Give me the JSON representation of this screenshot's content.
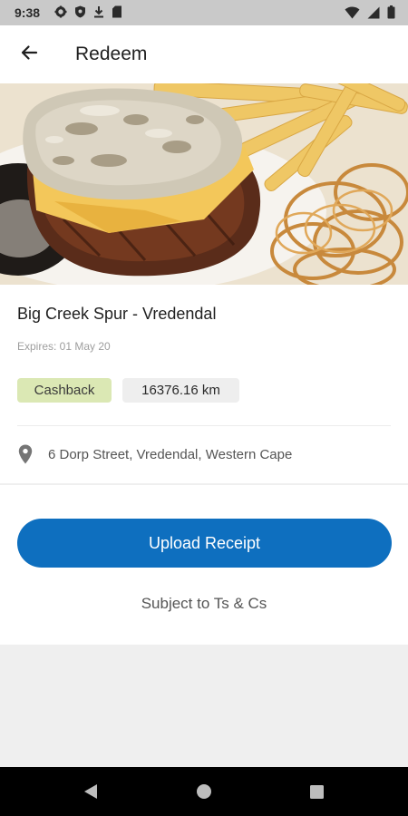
{
  "status_bar": {
    "time": "9:38",
    "left_icons": [
      "gear-icon",
      "shield-icon",
      "download-icon",
      "sd-card-icon"
    ],
    "right_icons": [
      "wifi-icon",
      "signal-icon",
      "battery-icon"
    ]
  },
  "app_bar": {
    "back_icon": "arrow-left-icon",
    "title": "Redeem"
  },
  "hero": {
    "image": "steak-with-mushroom-sauce-fries-onion-rings"
  },
  "offer": {
    "venue_name": "Big Creek Spur - Vredendal",
    "expires": "Expires: 01 May 20",
    "badges": {
      "type": "Cashback",
      "distance": "16376.16 km"
    },
    "address": "6 Dorp Street, Vredendal, Western Cape",
    "address_icon": "location-pin-icon"
  },
  "actions": {
    "upload_label": "Upload Receipt",
    "terms_label": "Subject to Ts & Cs"
  },
  "nav_bar": {
    "icons": [
      "back-triangle-icon",
      "home-circle-icon",
      "recents-square-icon"
    ]
  },
  "colors": {
    "primary_button": "#0e6fbf",
    "cashback_chip": "#dbe8b4",
    "distance_chip": "#eeeeee",
    "status_bar": "#c9c9c9"
  }
}
